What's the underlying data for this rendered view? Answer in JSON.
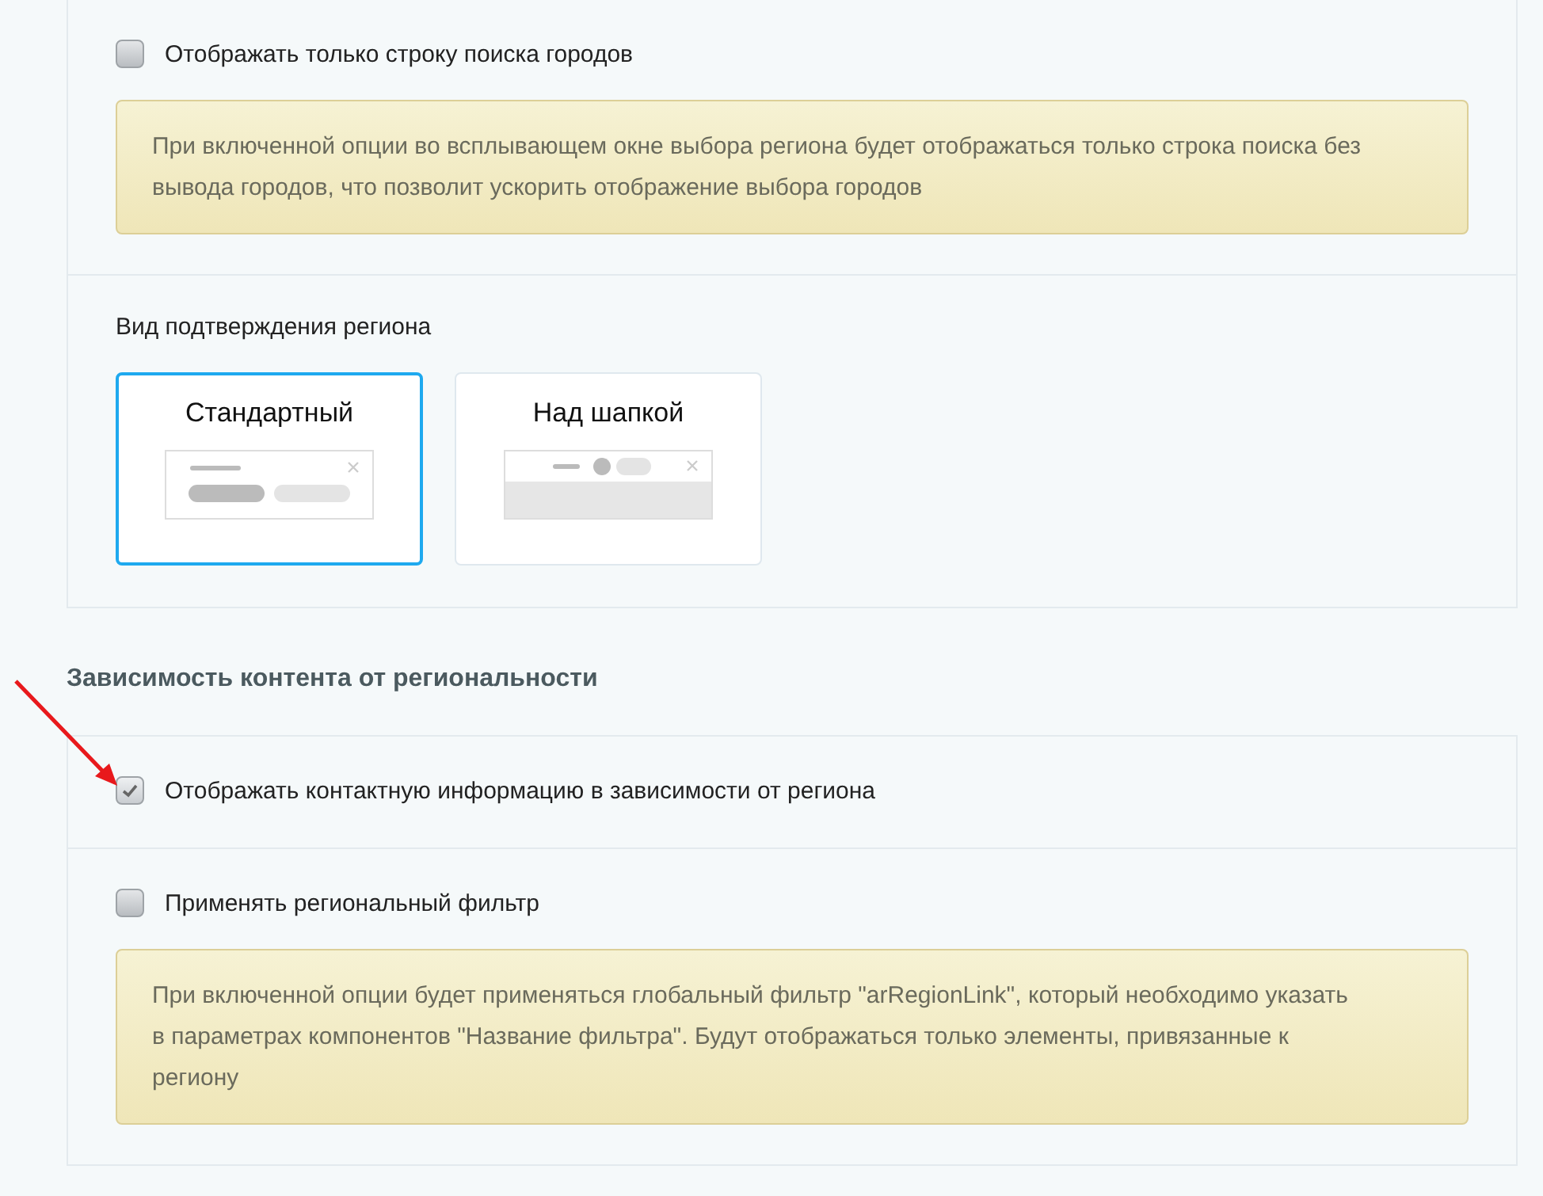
{
  "blocks": [
    {
      "kind": "checkbox",
      "label": "Отображать только строку поиска городов",
      "checked": false,
      "hint": "При включенной опции во всплывающем окне выбора региона будет отображаться только строка поиска без вывода городов, что позволит ускорить отображение выбора городов"
    },
    {
      "kind": "choice",
      "label": "Вид подтверждения региона",
      "options": [
        {
          "label": "Стандартный",
          "selected": true,
          "kind": "popup"
        },
        {
          "label": "Над шапкой",
          "selected": false,
          "kind": "banner"
        }
      ]
    },
    {
      "kind": "heading",
      "label": "Зависимость контента от региональности"
    },
    {
      "kind": "checkbox",
      "label": "Отображать контактную информацию в зависимости от региона",
      "checked": true
    },
    {
      "kind": "checkbox",
      "label": "Применять региональный фильтр",
      "checked": false,
      "hint": "При включенной опции будет применяться глобальный фильтр \"arRegionLink\", который необходимо указать в параметрах компонентов \"Название фильтра\". Будут отображаться только элементы, привязанные к региону"
    }
  ]
}
